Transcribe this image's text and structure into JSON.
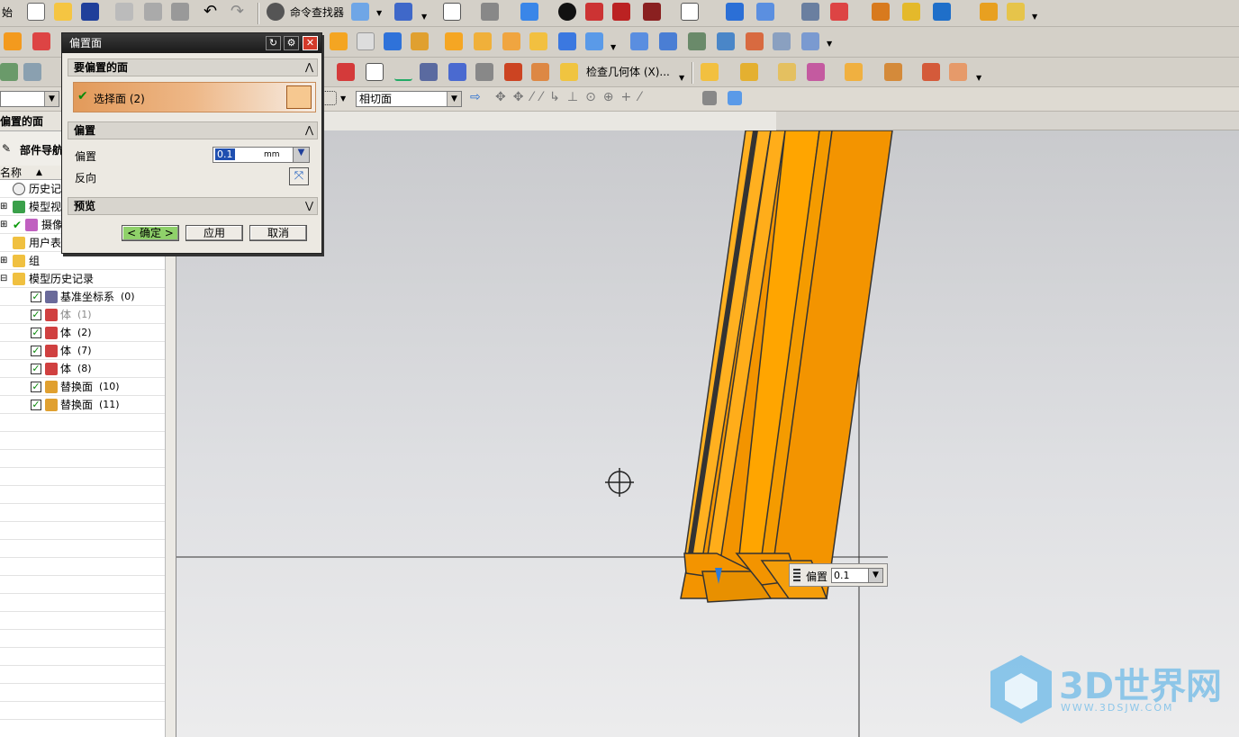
{
  "toolbar": {
    "start_label": "始",
    "command_finder": "命令查找器",
    "check_geometry": "检查几何体 (X)...",
    "filter_value": "相切面"
  },
  "navigator": {
    "panel_title": "偏置的面",
    "part_navigator": "部件导航",
    "name_column": "名称",
    "items": [
      {
        "label": "历史记"
      },
      {
        "label": "模型视"
      },
      {
        "label": "摄像"
      },
      {
        "label": "用户表"
      },
      {
        "label": "组"
      },
      {
        "label": "模型历史记录"
      }
    ],
    "history": [
      {
        "label": "基准坐标系",
        "tag": "(0)",
        "dim": false
      },
      {
        "label": "体",
        "tag": "(1)",
        "dim": true
      },
      {
        "label": "体",
        "tag": "(2)",
        "dim": false
      },
      {
        "label": "体",
        "tag": "(7)",
        "dim": false
      },
      {
        "label": "体",
        "tag": "(8)",
        "dim": false
      },
      {
        "label": "替换面",
        "tag": "(10)",
        "dim": false
      },
      {
        "label": "替换面",
        "tag": "(11)",
        "dim": false
      }
    ]
  },
  "dialog": {
    "title": "偏置面",
    "section_faces": "要偏置的面",
    "select_faces": "选择面 (2)",
    "section_offset": "偏置",
    "offset_label": "偏置",
    "offset_value": "0.1",
    "offset_unit": "mm",
    "reverse_label": "反向",
    "section_preview": "预览",
    "ok_label": "< 确定 >",
    "apply_label": "应用",
    "cancel_label": "取消"
  },
  "viewport": {
    "offset_tag_label": "偏置",
    "offset_tag_value": "0.1"
  },
  "watermark": {
    "brand": "3D世界网",
    "url": "WWW.3DSJW.COM"
  },
  "colors": {
    "model_orange": "#f39400",
    "model_light": "#ffb020",
    "accent_green": "#8fd16a"
  }
}
